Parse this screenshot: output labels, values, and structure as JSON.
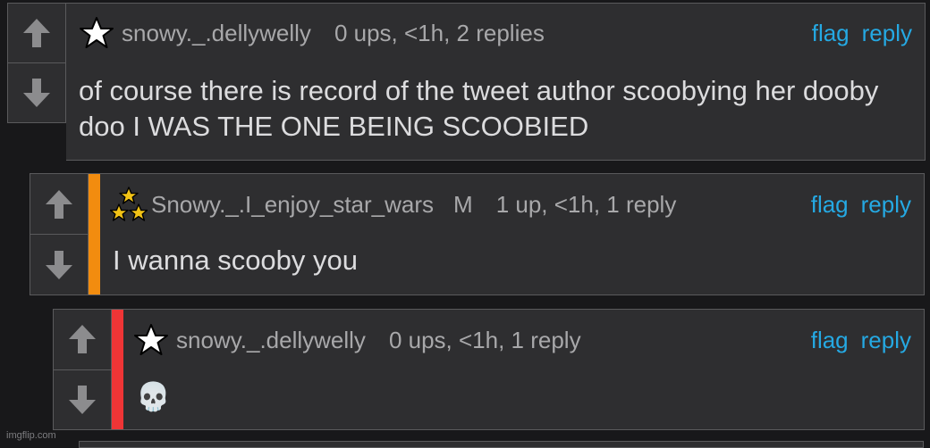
{
  "comments": [
    {
      "username": "snowy._.dellywelly",
      "meta": "0 ups, <1h, 2 replies",
      "flag_label": "flag",
      "reply_label": "reply",
      "text": "of course there is record of the tweet author scoobying her dooby doo I WAS THE ONE BEING SCOOBIED",
      "badge_icon": "star-icon"
    },
    {
      "username": "Snowy._.I_enjoy_star_wars",
      "mod_badge": "M",
      "meta": "1 up, <1h, 1 reply",
      "flag_label": "flag",
      "reply_label": "reply",
      "text": "I wanna scooby you",
      "badge_icon": "triple-star-icon",
      "stripe_color": "#f28c0f"
    },
    {
      "username": "snowy._.dellywelly",
      "meta": "0 ups, <1h, 1 reply",
      "flag_label": "flag",
      "reply_label": "reply",
      "text": "💀",
      "badge_icon": "star-icon",
      "stripe_color": "#ef3536"
    }
  ],
  "watermark": "imgflip.com",
  "colors": {
    "background": "#18181a",
    "panel": "#2e2e30",
    "border": "#5a5a5c",
    "link": "#25a9e3",
    "meta_text": "#a8a8aa",
    "body_text": "#dcdcde"
  }
}
